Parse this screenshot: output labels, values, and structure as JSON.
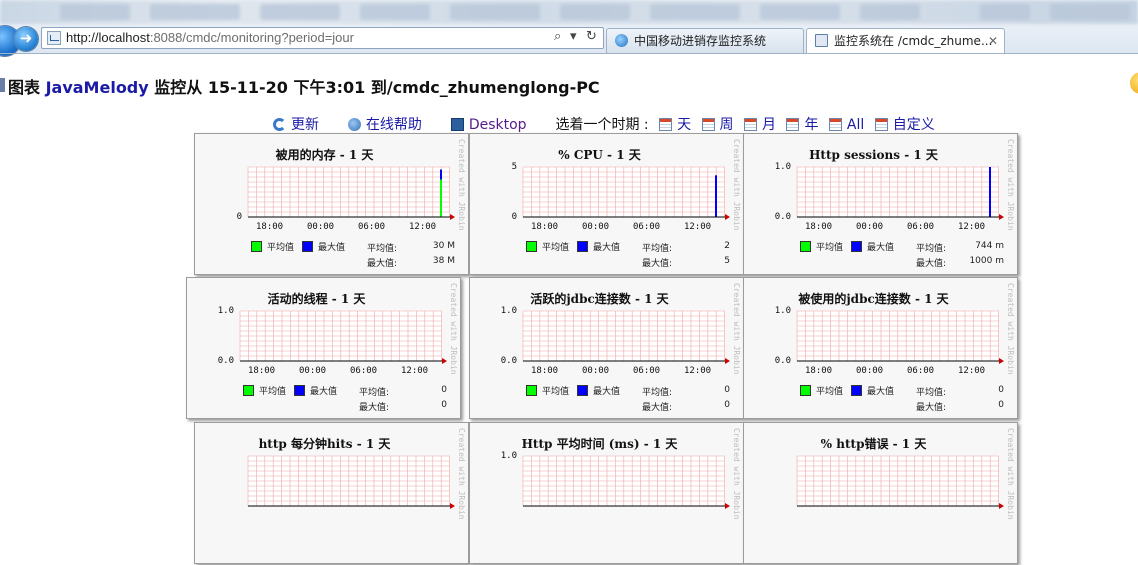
{
  "browser": {
    "address": {
      "host": "http://localhost",
      "rest": ":8088/cmdc/monitoring?period=jour"
    },
    "address_icons": {
      "search": "⌕",
      "dropdown": "▾",
      "refresh": "↻"
    },
    "tabs": [
      {
        "label": "中国移动进销存监控系统",
        "active": false
      },
      {
        "label": "监控系统在 /cmdc_zhume...",
        "active": true
      }
    ]
  },
  "page": {
    "title_prefix": "图表 ",
    "title_brand": "JavaMelody",
    "title_rest": " 监控从 15-11-20 下午3:01 到/cmdc_zhumenglong-PC"
  },
  "toolbar": {
    "refresh": "更新",
    "help": "在线帮助",
    "desktop": "Desktop",
    "choose_period": "选着一个时期 :",
    "periods": [
      "天",
      "周",
      "月",
      "年",
      "All",
      "自定义"
    ]
  },
  "charts": {
    "credit": "Created with JRobin",
    "x_ticks": [
      "18:00",
      "00:00",
      "06:00",
      "12:00"
    ],
    "legend_avg": "平均值",
    "legend_max": "最大值",
    "stat_avg_label": "平均值:",
    "stat_max_label": "最大值:",
    "colors": {
      "avg": "#00ff00",
      "max": "#0000ff",
      "grid": "#f0a8a8"
    }
  },
  "chart_data": [
    {
      "type": "area",
      "title": "被用的内存 - 1 天",
      "ylabel": "",
      "y_ticks": [
        "0"
      ],
      "ylim": [
        0,
        40
      ],
      "series": [
        {
          "name": "平均值",
          "last": 30
        },
        {
          "name": "最大值",
          "last": 38
        }
      ],
      "stat_avg": "30 M",
      "stat_max": "38 M"
    },
    {
      "type": "area",
      "title": "% CPU - 1 天",
      "ylabel": "",
      "y_ticks": [
        "5",
        "0"
      ],
      "ylim": [
        0,
        6
      ],
      "series": [
        {
          "name": "平均值",
          "last": 2
        },
        {
          "name": "最大值",
          "last": 5
        }
      ],
      "stat_avg": "2",
      "stat_max": "5"
    },
    {
      "type": "area",
      "title": "Http sessions - 1 天",
      "ylabel": "",
      "y_ticks": [
        "1.0",
        "0.0"
      ],
      "ylim": [
        0,
        1.0
      ],
      "series": [
        {
          "name": "平均值",
          "last": 0.744
        },
        {
          "name": "最大值",
          "last": 1.0
        }
      ],
      "stat_avg": "744 m",
      "stat_max": "1000 m"
    },
    {
      "type": "area",
      "title": "活动的线程 - 1 天",
      "ylabel": "",
      "y_ticks": [
        "1.0",
        "0.0"
      ],
      "ylim": [
        0,
        1.0
      ],
      "series": [
        {
          "name": "平均值",
          "last": 0
        },
        {
          "name": "最大值",
          "last": 0
        }
      ],
      "stat_avg": "0",
      "stat_max": "0"
    },
    {
      "type": "area",
      "title": "活跃的jdbc连接数 - 1 天",
      "ylabel": "",
      "y_ticks": [
        "1.0",
        "0.0"
      ],
      "ylim": [
        0,
        1.0
      ],
      "series": [
        {
          "name": "平均值",
          "last": 0
        },
        {
          "name": "最大值",
          "last": 0
        }
      ],
      "stat_avg": "0",
      "stat_max": "0"
    },
    {
      "type": "area",
      "title": "被使用的jdbc连接数 - 1 天",
      "ylabel": "",
      "y_ticks": [
        "1.0",
        "0.0"
      ],
      "ylim": [
        0,
        1.0
      ],
      "series": [
        {
          "name": "平均值",
          "last": 0
        },
        {
          "name": "最大值",
          "last": 0
        }
      ],
      "stat_avg": "0",
      "stat_max": "0"
    },
    {
      "type": "area",
      "title": "http 每分钟hits - 1 天",
      "ylabel": "",
      "y_ticks": [],
      "ylim": [
        0,
        1.0
      ],
      "series": [],
      "stat_avg": "",
      "stat_max": ""
    },
    {
      "type": "area",
      "title": "Http 平均时间 (ms) - 1 天",
      "ylabel": "",
      "y_ticks": [
        "1.0"
      ],
      "ylim": [
        0,
        1.0
      ],
      "series": [],
      "stat_avg": "",
      "stat_max": ""
    },
    {
      "type": "area",
      "title": "% http错误 - 1 天",
      "ylabel": "",
      "y_ticks": [],
      "ylim": [
        0,
        1.0
      ],
      "series": [],
      "stat_avg": "",
      "stat_max": ""
    }
  ]
}
